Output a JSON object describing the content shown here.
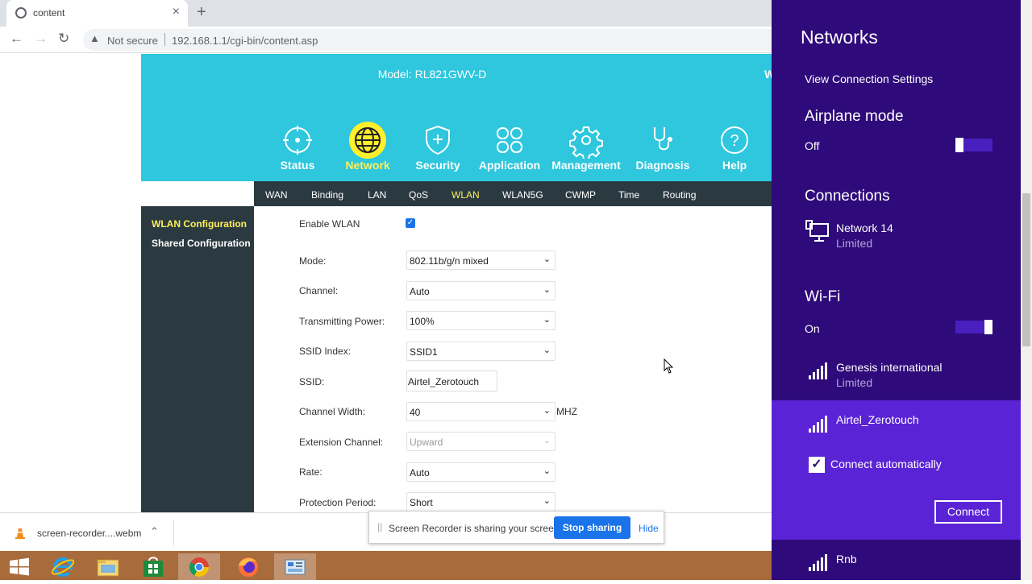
{
  "browser": {
    "tab_title": "content",
    "not_secure": "Not secure",
    "url": "192.168.1.1/cgi-bin/content.asp"
  },
  "router": {
    "model": "Model: RL821GWV-D",
    "cut_text": "W",
    "nav": [
      {
        "label": "Status",
        "icon": "crosshair-icon"
      },
      {
        "label": "Network",
        "icon": "globe-icon"
      },
      {
        "label": "Security",
        "icon": "shield-plus-icon"
      },
      {
        "label": "Application",
        "icon": "apps-grid-icon"
      },
      {
        "label": "Management",
        "icon": "gear-icon"
      },
      {
        "label": "Diagnosis",
        "icon": "stethoscope-icon"
      },
      {
        "label": "Help",
        "icon": "help-icon"
      }
    ],
    "active_nav": "Network",
    "subnav": [
      "WAN",
      "Binding",
      "LAN",
      "QoS",
      "WLAN",
      "WLAN5G",
      "CWMP",
      "Time",
      "Routing"
    ],
    "active_subnav": "WLAN",
    "sidebar": [
      "WLAN Configuration",
      "Shared Configuration"
    ],
    "form": {
      "enable_wlan": "Enable WLAN",
      "mode_label": "Mode:",
      "mode_value": "802.11b/g/n mixed",
      "channel_label": "Channel:",
      "channel_value": "Auto",
      "power_label": "Transmitting Power:",
      "power_value": "100%",
      "ssid_index_label": "SSID Index:",
      "ssid_index_value": "SSID1",
      "ssid_label": "SSID:",
      "ssid_value": "Airtel_Zerotouch",
      "width_label": "Channel Width:",
      "width_value": "40",
      "width_unit": "MHZ",
      "ext_label": "Extension Channel:",
      "ext_value": "Upward",
      "rate_label": "Rate:",
      "rate_value": "Auto",
      "protect_label": "Protection Period:",
      "protect_value": "Short"
    }
  },
  "downloads": {
    "file": "screen-recorder....webm"
  },
  "share": {
    "message": "Screen Recorder is sharing your screen.",
    "stop": "Stop sharing",
    "hide": "Hide"
  },
  "networks": {
    "title": "Networks",
    "view_settings": "View Connection Settings",
    "airplane_label": "Airplane mode",
    "airplane_state": "Off",
    "connections_label": "Connections",
    "conn_name": "Network  14",
    "conn_status": "Limited",
    "wifi_label": "Wi-Fi",
    "wifi_state": "On",
    "wifi_list": [
      {
        "name": "Genesis international",
        "status": "Limited"
      },
      {
        "name": "Airtel_Zerotouch"
      },
      {
        "name": "Rnb"
      }
    ],
    "connect_auto": "Connect automatically",
    "connect_btn": "Connect"
  }
}
